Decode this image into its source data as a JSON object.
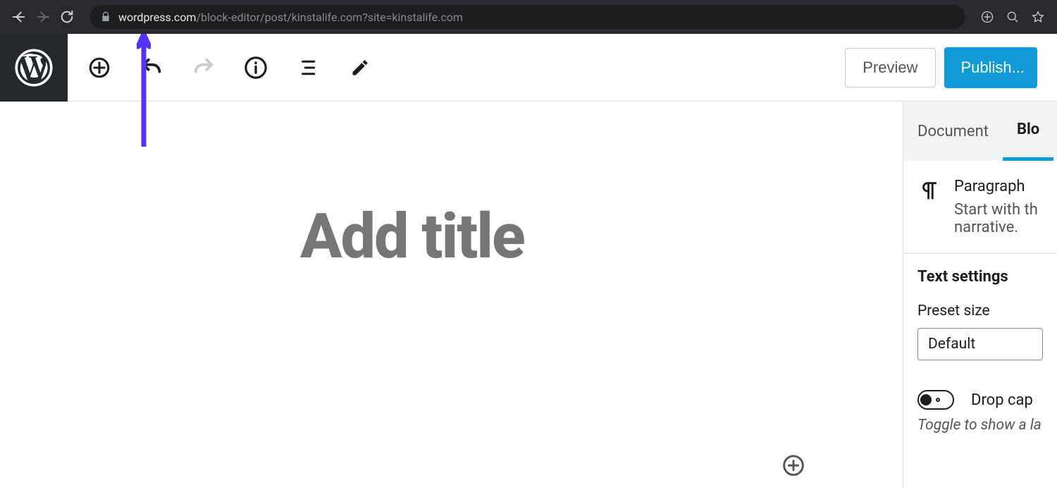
{
  "browser": {
    "url_domain": "wordpress.com",
    "url_path": "/block-editor/post/kinstalife.com?site=kinstalife.com"
  },
  "toolbar": {
    "preview_label": "Preview",
    "publish_label": "Publish..."
  },
  "editor": {
    "title_placeholder": "Add title"
  },
  "sidebar": {
    "tabs": {
      "document": "Document",
      "block": "Blo"
    },
    "block_summary": {
      "title": "Paragraph",
      "description": "Start with th\nnarrative."
    },
    "text_settings": {
      "heading": "Text settings",
      "preset_label": "Preset size",
      "preset_value": "Default",
      "dropcap_label": "Drop cap",
      "dropcap_help": "Toggle to show a la"
    }
  }
}
